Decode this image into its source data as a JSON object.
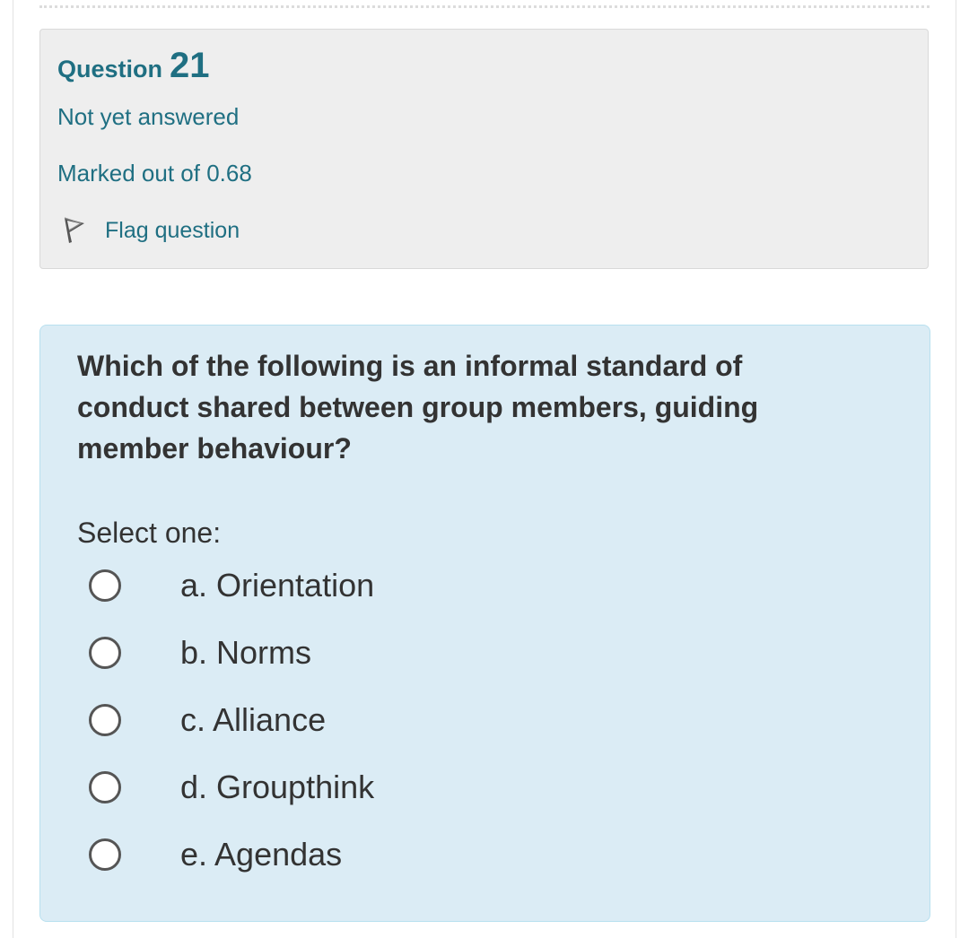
{
  "question": {
    "number_label": "Question",
    "number": "21",
    "state": "Not yet answered",
    "grade": "Marked out of 0.68",
    "flag_label": "Flag question",
    "icons": {
      "flag": "flag-outline-icon"
    },
    "colors": {
      "accent_text": "#1f6f82",
      "info_bg": "#eeeeee",
      "content_bg": "#dbecf5",
      "content_border": "#b8e0ef"
    }
  },
  "content": {
    "text": "Which of the following is an informal standard of conduct shared between group members, guiding member behaviour?",
    "prompt": "Select one:",
    "options": [
      {
        "label": "a. Orientation",
        "selected": false
      },
      {
        "label": "b. Norms",
        "selected": false
      },
      {
        "label": "c. Alliance",
        "selected": false
      },
      {
        "label": "d. Groupthink",
        "selected": false
      },
      {
        "label": "e. Agendas",
        "selected": false
      }
    ]
  }
}
